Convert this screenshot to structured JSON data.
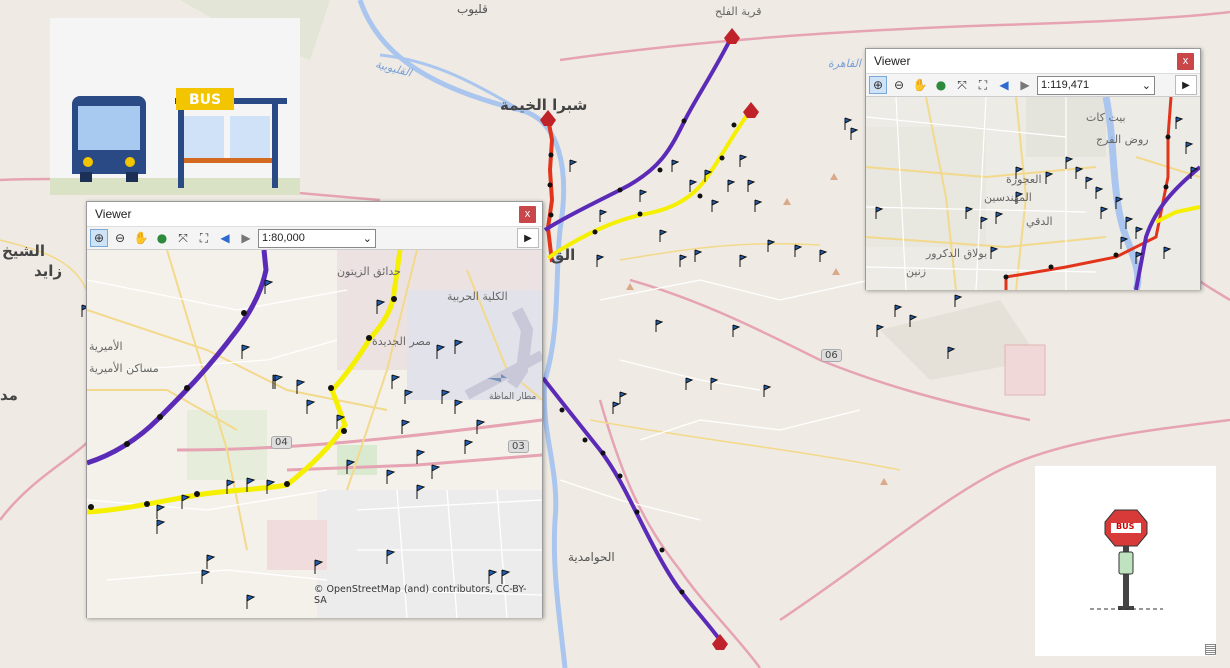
{
  "map": {
    "places": [
      {
        "id": "qalyub",
        "label": "قليوب"
      },
      {
        "id": "qaryat_alfalah",
        "label": "قرية الفلح"
      },
      {
        "id": "shubra",
        "label": "شبرا الخيمة"
      },
      {
        "id": "qalyubia",
        "label": "القليوبية"
      },
      {
        "id": "cairo",
        "label": "القاهرة"
      },
      {
        "id": "sheikh",
        "label": "الشيخ"
      },
      {
        "id": "zayed",
        "label": "زايد"
      },
      {
        "id": "madi",
        "label": "مد"
      },
      {
        "id": "hawamdiya",
        "label": "الحوامدية"
      },
      {
        "id": "qa",
        "label": "الق"
      }
    ],
    "road_shield": "06",
    "colors": {
      "purple_line": "#5b2bb8",
      "yellow_line": "#f5ef00",
      "red_line": "#e2341a",
      "stop_flag": "#1f5fb8",
      "road_pink": "#e6a3b3"
    }
  },
  "viewer_left": {
    "title": "Viewer",
    "close": "x",
    "scale": "1:80,000",
    "attribution": "© OpenStreetMap (and) contributors, CC-BY-SA",
    "labels": {
      "zaitoun": "حدائق الزيتون",
      "misr_jadida": "مصر الجديدة",
      "amiriya": "الأميرية",
      "masakin": "مساكن الأميرية",
      "harbiya": "الكلية الحربية",
      "matar": "مطار الماظة",
      "shield_04": "04",
      "shield_03": "03"
    }
  },
  "viewer_right": {
    "title": "Viewer",
    "close": "x",
    "scale": "1:119,471",
    "labels": {
      "rawd_faraj": "روض الفرج",
      "bayt_kat": "بيت كات",
      "ajouza": "العجوزة",
      "mohandiseen": "المهندسين",
      "duqqi": "الدقي",
      "zeinin": "زنين",
      "bulaq": "بولاق الدكرور"
    }
  },
  "illustration": {
    "bus_label": "BUS"
  },
  "bus_sign": {
    "label": "BUS"
  }
}
